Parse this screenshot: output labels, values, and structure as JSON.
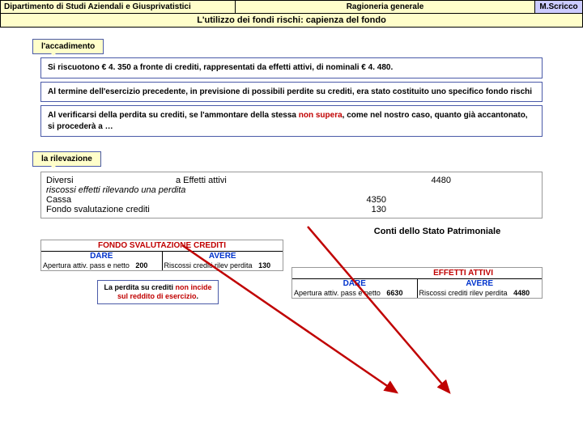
{
  "header": {
    "left": "Dipartimento di Studi Aziendali e Giusprivatistici",
    "center": "Ragioneria generale",
    "right": "M.Scricco"
  },
  "subtitle": "L'utilizzo dei fondi rischi: capienza del fondo",
  "tag1": "l'accadimento",
  "box1": "Si riscuotono € 4. 350 a fronte di crediti, rappresentati da effetti attivi, di nominali € 4. 480.",
  "box2": "Al termine dell'esercizio precedente, in previsione di possibili perdite su crediti, era stato costituito uno specifico fondo rischi",
  "box3a": "Al verificarsi della perdita su crediti, se l'ammontare della stessa ",
  "box3b": "non supera",
  "box3c": ", come nel nostro caso, quanto già accantonato, si procederà a …",
  "tag2": "la rilevazione",
  "journal": {
    "r1": {
      "c1": "Diversi",
      "c2": "a  Effetti attivi",
      "c4": "4480"
    },
    "r2": {
      "c1": "riscossi effetti rilevando una perdita",
      "cls": "ital"
    },
    "r3": {
      "c1": "Cassa",
      "c3": "4350"
    },
    "r4": {
      "c1": "Fondo svalutazione crediti",
      "c3": "130"
    }
  },
  "sp": "Conti dello Stato Patrimoniale",
  "t1": {
    "title": "FONDO SVALUTAZIONE CREDITI",
    "dare": "DARE",
    "avere": "AVERE",
    "dl": "Apertura attiv. pass e netto",
    "dv": "200",
    "al": "Riscossi crediti rilev perdita",
    "av": "130"
  },
  "t2": {
    "title": "EFFETTI ATTIVI",
    "dare": "DARE",
    "avere": "AVERE",
    "dl": "Apertura attiv. pass e netto",
    "dv": "6630",
    "al": "Riscossi crediti rilev perdita",
    "av": "4480"
  },
  "callout": {
    "a": "La perdita su crediti ",
    "b": "non incide sul reddito di esercizio",
    "c": "."
  }
}
